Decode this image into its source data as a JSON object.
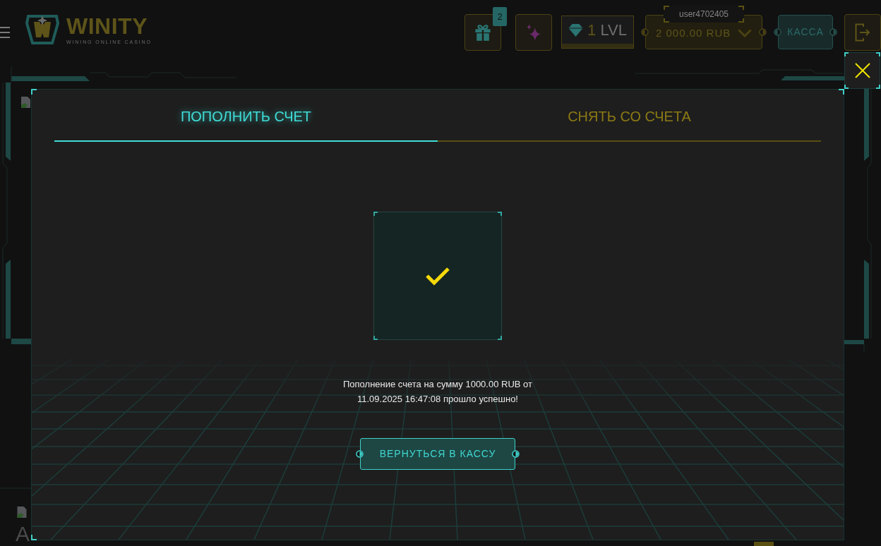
{
  "header": {
    "logo": {
      "name": "WINITY",
      "tagline": "WINING ONLINE CASINO"
    },
    "gift_badge": "2",
    "level": {
      "number": "1",
      "unit": "LVL"
    },
    "username": "user4702405",
    "balance": "2 000.00 RUB",
    "cashier_button": "КАССА"
  },
  "modal": {
    "tabs": [
      {
        "label": "ПОПОЛНИТЬ СЧЕТ",
        "selected": true
      },
      {
        "label": "СНЯТЬ СО СЧЕТА",
        "selected": false
      }
    ],
    "message": "Пополнение счета на сумму 1000.00 RUB от 11.09.2025 16:47:08 прошло успешно!",
    "return_button": "ВЕРНУТЬСЯ В КАССУ"
  },
  "background": {
    "heading_fragment": "A"
  }
}
